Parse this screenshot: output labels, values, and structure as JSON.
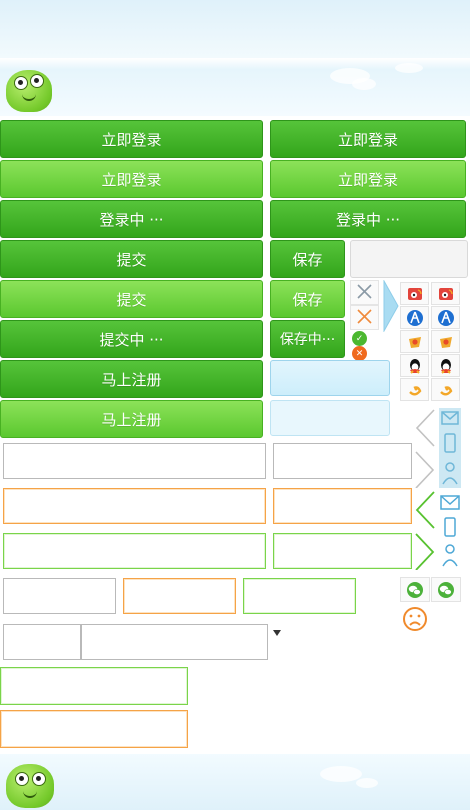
{
  "login": {
    "dark": "立即登录",
    "light": "立即登录",
    "loading": "登录中 ···"
  },
  "submit": {
    "dark": "提交",
    "light": "提交",
    "loading": "提交中 ···"
  },
  "save": {
    "dark": "保存",
    "light": "保存",
    "loading": "保存中···"
  },
  "register": {
    "dark": "马上注册",
    "light": "马上注册"
  },
  "icons": {
    "close_gray": "close-icon",
    "close_orange": "close-icon",
    "success": "check-circle-icon",
    "error": "error-circle-icon",
    "social": [
      "weibo-icon",
      "renren-icon",
      "tencent-weibo-icon",
      "qq-icon",
      "pengyou-icon"
    ],
    "wechat": "wechat-icon",
    "sad": "sad-face-icon",
    "mail": "mail-icon",
    "phone": "phone-icon",
    "user": "user-icon"
  },
  "colors": {
    "green_dark": "#33a51b",
    "green_light": "#5bc82f",
    "orange": "#f5a347",
    "blue_light": "#cdeefb"
  }
}
